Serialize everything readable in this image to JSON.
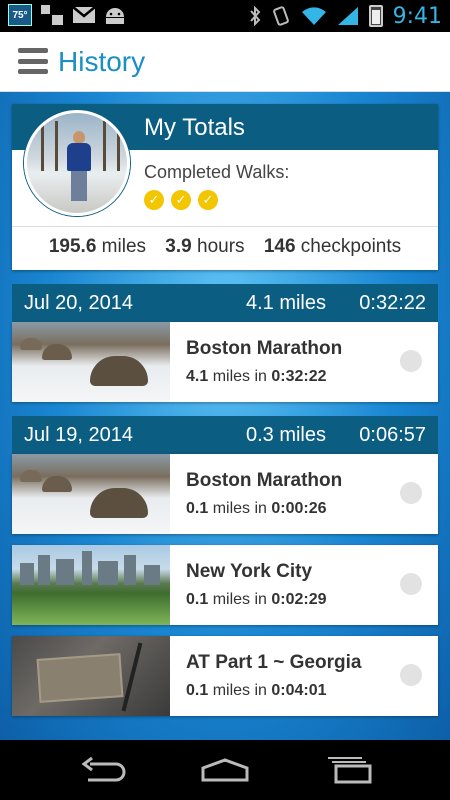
{
  "status_bar": {
    "temperature": "75°",
    "time": "9:41"
  },
  "action_bar": {
    "title": "History"
  },
  "totals": {
    "title": "My Totals",
    "completed_label": "Completed Walks:",
    "completed_count": 3,
    "badge_glyph": "✓",
    "miles_value": "195.6",
    "miles_unit": "miles",
    "hours_value": "3.9",
    "hours_unit": "hours",
    "checkpoints_value": "146",
    "checkpoints_unit": "checkpoints"
  },
  "days": [
    {
      "date": "Jul 20, 2014",
      "miles": "4.1 miles",
      "time": "0:32:22",
      "walks": [
        {
          "name": "Boston Marathon",
          "miles": "4.1",
          "miles_in": "miles in",
          "time": "0:32:22",
          "image": "boston-tortoise-photo"
        }
      ]
    },
    {
      "date": "Jul 19, 2014",
      "miles": "0.3 miles",
      "time": "0:06:57",
      "walks": [
        {
          "name": "Boston Marathon",
          "miles": "0.1",
          "miles_in": "miles in",
          "time": "0:00:26",
          "image": "boston-tortoise-photo"
        },
        {
          "name": "New York City",
          "miles": "0.1",
          "miles_in": "miles in",
          "time": "0:02:29",
          "image": "central-park-photo"
        },
        {
          "name": "AT Part 1 ~ Georgia",
          "miles": "0.1",
          "miles_in": "miles in",
          "time": "0:04:01",
          "image": "trail-plaque-photo"
        }
      ]
    }
  ],
  "colors": {
    "accent": "#1b8fc4",
    "header": "#0c5d82",
    "badge": "#f2c600"
  }
}
